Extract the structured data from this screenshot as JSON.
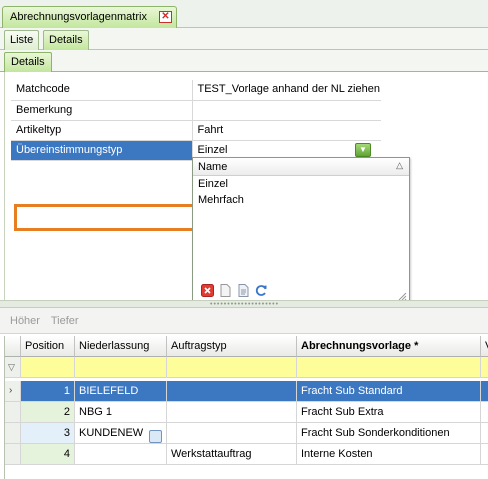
{
  "document_tab": {
    "title": "Abrechnungsvorlagenmatrix"
  },
  "view_tabs": [
    {
      "label": "Liste"
    },
    {
      "label": "Details"
    }
  ],
  "inner_tab": {
    "label": "Details"
  },
  "properties": [
    {
      "label": "Matchcode",
      "value": "TEST_Vorlage anhand der NL ziehen"
    },
    {
      "label": "Bemerkung",
      "value": ""
    },
    {
      "label": "Artikeltyp",
      "value": "Fahrt"
    },
    {
      "label": "Übereinstimmungstyp",
      "value": "Einzel"
    }
  ],
  "dropdown": {
    "header": "Name",
    "options": [
      "Einzel",
      "Mehrfach"
    ]
  },
  "toolbar": {
    "up_label": "Höher",
    "down_label": "Tiefer"
  },
  "grid": {
    "columns": [
      "Position",
      "Niederlassung",
      "Auftragstyp",
      "Abrechnungsvorlage *",
      "V"
    ],
    "rows": [
      {
        "position": "1",
        "niederlassung": "BIELEFELD",
        "auftragstyp": "",
        "vorlage": "Fracht Sub Standard"
      },
      {
        "position": "2",
        "niederlassung": "NBG 1",
        "auftragstyp": "",
        "vorlage": "Fracht Sub Extra"
      },
      {
        "position": "3",
        "niederlassung": "KUNDENEW",
        "auftragstyp": "",
        "vorlage": "Fracht Sub Sonderkonditionen"
      },
      {
        "position": "4",
        "niederlassung": "",
        "auftragstyp": "Werkstattauftrag",
        "vorlage": "Interne Kosten"
      }
    ]
  },
  "colors": {
    "selection": "#3c78c2",
    "highlight_border": "#e87e22",
    "filter_row": "#fdfd9a",
    "tab_green": "#c3e69e"
  }
}
